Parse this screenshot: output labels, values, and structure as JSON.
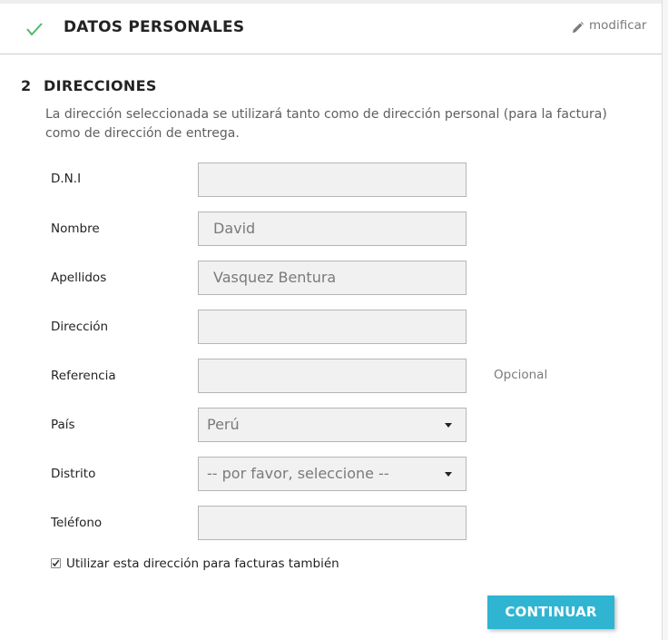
{
  "step1": {
    "title": "DATOS PERSONALES",
    "modify_label": "modificar",
    "check_icon": "check-icon",
    "check_color": "#4cbb6c"
  },
  "step2": {
    "number": "2",
    "title": "DIRECCIONES",
    "description": "La dirección seleccionada se utilizará tanto como de dirección personal (para la factura) como de dirección de entrega."
  },
  "fields": {
    "dni": {
      "label": "D.N.I",
      "value": ""
    },
    "nombre": {
      "label": "Nombre",
      "value": "David"
    },
    "apellidos": {
      "label": "Apellidos",
      "value": "Vasquez Bentura"
    },
    "direccion": {
      "label": "Dirección",
      "value": ""
    },
    "referencia": {
      "label": "Referencia",
      "value": "",
      "hint": "Opcional"
    },
    "pais": {
      "label": "País",
      "value": "Perú"
    },
    "distrito": {
      "label": "Distrito",
      "value": "-- por favor, seleccione --"
    },
    "telefono": {
      "label": "Teléfono",
      "value": ""
    }
  },
  "invoice_checkbox": {
    "label": "Utilizar esta dirección para facturas también",
    "checked": true
  },
  "continue_button": {
    "label": "CONTINUAR",
    "color": "#2fb5d2"
  }
}
